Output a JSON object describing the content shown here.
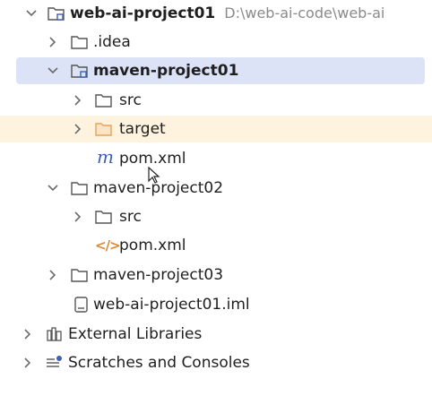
{
  "project_tree": {
    "root": {
      "name": "web-ai-project01",
      "path": "D:\\web-ai-code\\web-ai"
    },
    "items": [
      {
        "name": ".idea"
      },
      {
        "name": "maven-project01"
      },
      {
        "name": "src"
      },
      {
        "name": "target"
      },
      {
        "name": "pom.xml"
      },
      {
        "name": "maven-project02"
      },
      {
        "name": "src"
      },
      {
        "name": "pom.xml"
      },
      {
        "name": "maven-project03"
      },
      {
        "name": "web-ai-project01.iml"
      }
    ],
    "external_libraries": "External Libraries",
    "scratches": "Scratches and Consoles"
  },
  "icons": {
    "module_folder": "module-folder-icon",
    "folder": "folder-icon",
    "excluded_folder": "excluded-folder-icon",
    "maven_file": "maven-pom-icon",
    "xml_file": "xml-file-icon",
    "iml_file": "iml-file-icon",
    "libraries": "external-libraries-icon",
    "scratches": "scratches-icon"
  },
  "colors": {
    "selection": "#dde3f7",
    "excluded_row": "#fdf3df",
    "path_text": "#8a8a8a",
    "maven_blue": "#3d5fb8",
    "xml_orange": "#d98a37",
    "excluded_folder": "#e7a35a"
  }
}
